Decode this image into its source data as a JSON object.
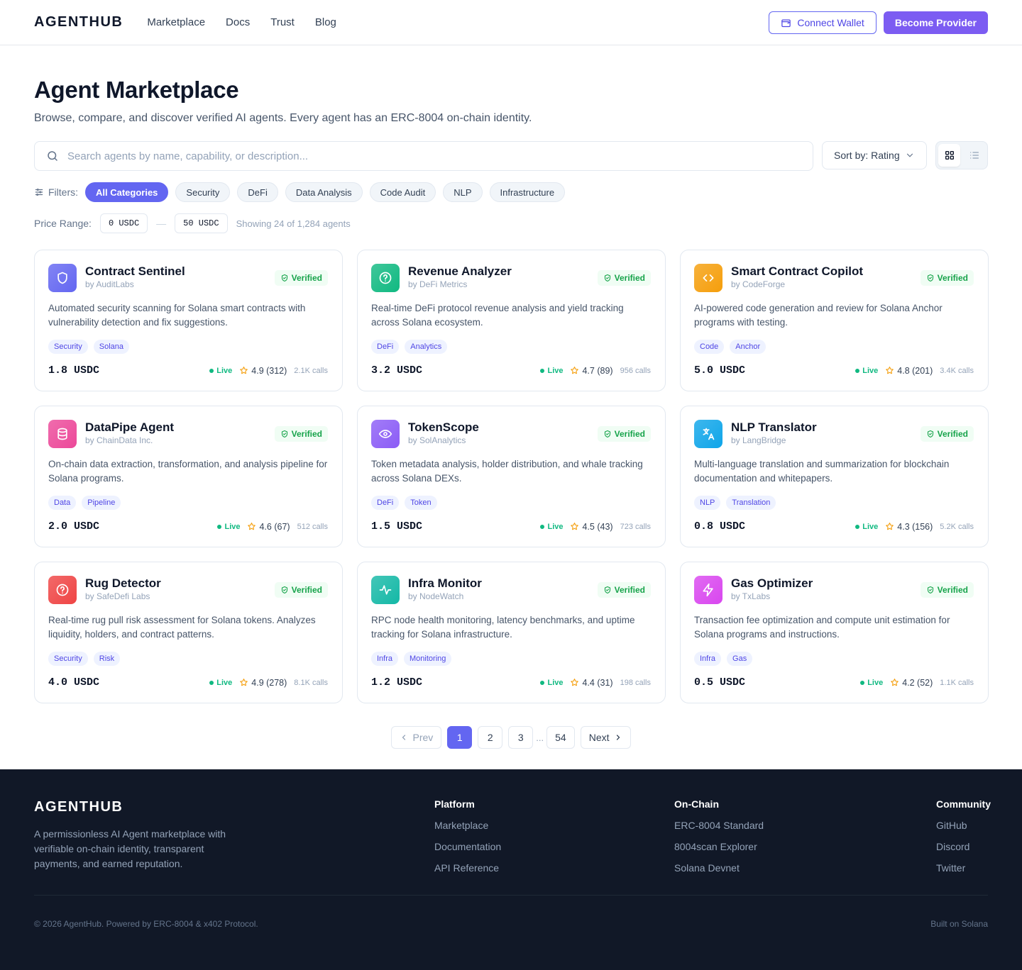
{
  "header": {
    "logo": "AGENTHUB",
    "nav": [
      "Marketplace",
      "Docs",
      "Trust",
      "Blog"
    ],
    "connect_wallet": "Connect Wallet",
    "become_provider": "Become Provider"
  },
  "page": {
    "title": "Agent Marketplace",
    "subtitle": "Browse, compare, and discover verified AI agents. Every agent has an ERC-8004 on-chain identity."
  },
  "search": {
    "placeholder": "Search agents by name, capability, or description...",
    "value": ""
  },
  "sort": {
    "label": "Sort by: Rating"
  },
  "view": {
    "active": "grid"
  },
  "filters": {
    "label": "Filters:",
    "categories": [
      "All Categories",
      "Security",
      "DeFi",
      "Data Analysis",
      "Code Audit",
      "NLP",
      "Infrastructure"
    ],
    "active": "All Categories"
  },
  "price_range": {
    "label": "Price Range:",
    "min": "0 USDC",
    "separator": "—",
    "max": "50 USDC",
    "showing": "Showing 24 of 1,284 agents"
  },
  "verified_label": "Verified",
  "live_label": "Live",
  "agents": [
    {
      "name": "Contract Sentinel",
      "by": "by AuditLabs",
      "icon": "shield-icon",
      "color": "#6366f1",
      "desc": "Automated security scanning for Solana smart contracts with vulnerability detection and fix suggestions.",
      "tags": [
        "Security",
        "Solana"
      ],
      "price": "1.8 USDC",
      "rating": "4.9 (312)",
      "calls": "2.1K calls"
    },
    {
      "name": "Revenue Analyzer",
      "by": "by DeFi Metrics",
      "icon": "help-circle-icon",
      "color": "#10b981",
      "desc": "Real-time DeFi protocol revenue analysis and yield tracking across Solana ecosystem.",
      "tags": [
        "DeFi",
        "Analytics"
      ],
      "price": "3.2 USDC",
      "rating": "4.7 (89)",
      "calls": "956 calls"
    },
    {
      "name": "Smart Contract Copilot",
      "by": "by CodeForge",
      "icon": "code-icon",
      "color": "#f59e0b",
      "desc": "AI-powered code generation and review for Solana Anchor programs with testing.",
      "tags": [
        "Code",
        "Anchor"
      ],
      "price": "5.0 USDC",
      "rating": "4.8 (201)",
      "calls": "3.4K calls"
    },
    {
      "name": "DataPipe Agent",
      "by": "by ChainData Inc.",
      "icon": "database-icon",
      "color": "#ec4899",
      "desc": "On-chain data extraction, transformation, and analysis pipeline for Solana programs.",
      "tags": [
        "Data",
        "Pipeline"
      ],
      "price": "2.0 USDC",
      "rating": "4.6 (67)",
      "calls": "512 calls"
    },
    {
      "name": "TokenScope",
      "by": "by SolAnalytics",
      "icon": "eye-icon",
      "color": "#8b5cf6",
      "desc": "Token metadata analysis, holder distribution, and whale tracking across Solana DEXs.",
      "tags": [
        "DeFi",
        "Token"
      ],
      "price": "1.5 USDC",
      "rating": "4.5 (43)",
      "calls": "723 calls"
    },
    {
      "name": "NLP Translator",
      "by": "by LangBridge",
      "icon": "translate-icon",
      "color": "#0ea5e9",
      "desc": "Multi-language translation and summarization for blockchain documentation and whitepapers.",
      "tags": [
        "NLP",
        "Translation"
      ],
      "price": "0.8 USDC",
      "rating": "4.3 (156)",
      "calls": "5.2K calls"
    },
    {
      "name": "Rug Detector",
      "by": "by SafeDefi Labs",
      "icon": "help-circle-icon",
      "color": "#ef4444",
      "desc": "Real-time rug pull risk assessment for Solana tokens. Analyzes liquidity, holders, and contract patterns.",
      "tags": [
        "Security",
        "Risk"
      ],
      "price": "4.0 USDC",
      "rating": "4.9 (278)",
      "calls": "8.1K calls"
    },
    {
      "name": "Infra Monitor",
      "by": "by NodeWatch",
      "icon": "activity-icon",
      "color": "#14b8a6",
      "desc": "RPC node health monitoring, latency benchmarks, and uptime tracking for Solana infrastructure.",
      "tags": [
        "Infra",
        "Monitoring"
      ],
      "price": "1.2 USDC",
      "rating": "4.4 (31)",
      "calls": "198 calls"
    },
    {
      "name": "Gas Optimizer",
      "by": "by TxLabs",
      "icon": "zap-icon",
      "color": "#d946ef",
      "desc": "Transaction fee optimization and compute unit estimation for Solana programs and instructions.",
      "tags": [
        "Infra",
        "Gas"
      ],
      "price": "0.5 USDC",
      "rating": "4.2 (52)",
      "calls": "1.1K calls"
    }
  ],
  "pagination": {
    "prev": "Prev",
    "pages": [
      "1",
      "2",
      "3"
    ],
    "ellipsis": "...",
    "last": "54",
    "next": "Next",
    "current": "1"
  },
  "footer": {
    "logo": "AGENTHUB",
    "tagline": "A permissionless AI Agent marketplace with verifiable on-chain identity, transparent payments, and earned reputation.",
    "columns": [
      {
        "title": "Platform",
        "links": [
          "Marketplace",
          "Documentation",
          "API Reference"
        ]
      },
      {
        "title": "On-Chain",
        "links": [
          "ERC-8004 Standard",
          "8004scan Explorer",
          "Solana Devnet"
        ]
      },
      {
        "title": "Community",
        "links": [
          "GitHub",
          "Discord",
          "Twitter"
        ]
      }
    ],
    "copyright": "© 2026 AgentHub. Powered by ERC-8004 & x402 Protocol.",
    "built_on": "Built on Solana"
  }
}
